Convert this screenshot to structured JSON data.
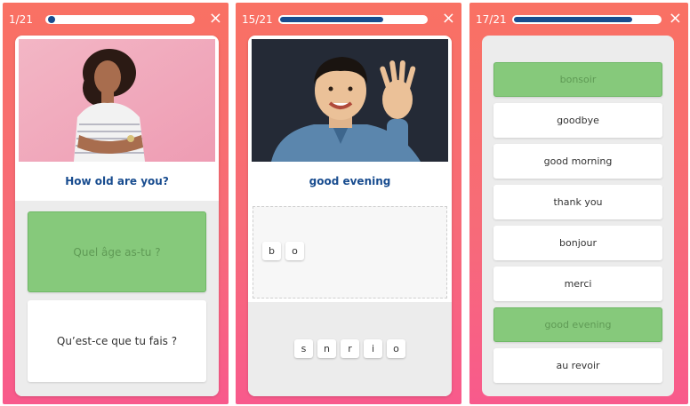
{
  "colors": {
    "background_gradient_top": "#f97163",
    "background_gradient_bottom": "#f85a8c",
    "progress": "#184c8f",
    "prompt_text": "#184c8f",
    "selected_option": "#86c97b"
  },
  "screen1": {
    "counter": "1/21",
    "progress_fraction": 0.05,
    "close_icon": "×",
    "prompt": "How old are you?",
    "options": [
      {
        "label": "Quel âge as-tu ?",
        "selected": true
      },
      {
        "label": "Qu’est-ce que tu fais ?",
        "selected": false
      }
    ]
  },
  "screen2": {
    "counter": "15/21",
    "progress_fraction": 0.71,
    "close_icon": "×",
    "prompt": "good evening",
    "answer_tiles": [
      "b",
      "o"
    ],
    "letter_tiles": [
      "s",
      "n",
      "r",
      "i",
      "o"
    ]
  },
  "screen3": {
    "counter": "17/21",
    "progress_fraction": 0.81,
    "close_icon": "×",
    "options": [
      {
        "label": "bonsoir",
        "selected": true
      },
      {
        "label": "goodbye",
        "selected": false
      },
      {
        "label": "good morning",
        "selected": false
      },
      {
        "label": "thank you",
        "selected": false
      },
      {
        "label": "bonjour",
        "selected": false
      },
      {
        "label": "merci",
        "selected": false
      },
      {
        "label": "good evening",
        "selected": true
      },
      {
        "label": "au revoir",
        "selected": false
      }
    ]
  }
}
